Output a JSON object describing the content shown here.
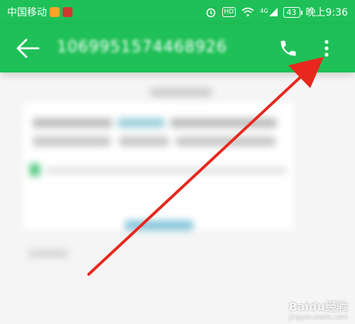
{
  "status_bar": {
    "carrier": "中国移动",
    "network": "4G",
    "battery": "43",
    "time": "晚上9:36",
    "hd_badge": "HD",
    "icons": [
      "app-icon-video",
      "app-icon-shop",
      "alarm-icon",
      "hd-icon",
      "wifi-icon",
      "signal-icon",
      "battery-icon"
    ]
  },
  "toolbar": {
    "phone_number": "1069951574468926",
    "icons": [
      "back-arrow-icon",
      "phone-icon",
      "more-vert-icon"
    ]
  },
  "colors": {
    "toolbar_green": "#1fc057",
    "annotation_red": "#e8281e"
  },
  "watermark": {
    "brand": "Baidu经验",
    "url": "jingyan.baidu.com"
  }
}
